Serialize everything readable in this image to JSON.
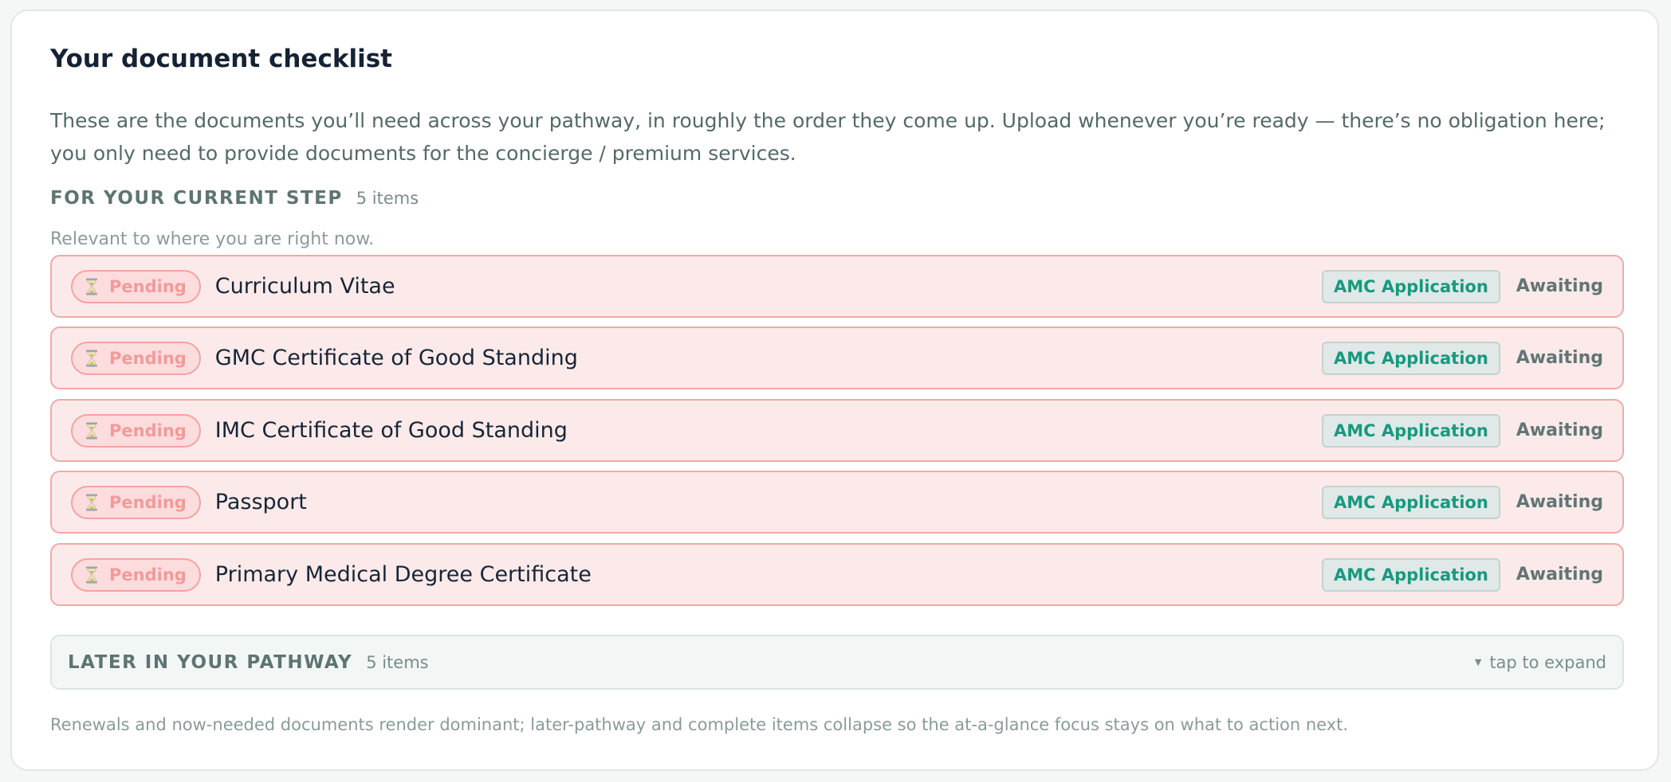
{
  "checklist": {
    "title": "Your document checklist",
    "intro": "These are the documents you’ll need across your pathway, in roughly the order they come up. Upload whenever you’re ready — there’s no obligation here; you only need to provide documents for the concierge / premium services.",
    "current_section": {
      "label": "FOR YOUR CURRENT STEP",
      "count": "5 items",
      "subtitle": "Relevant to where you are right now."
    },
    "documents": [
      {
        "status": "Pending",
        "status_icon": "hourglass-icon",
        "name": "Curriculum Vitae",
        "step": "AMC Application",
        "state": "Awaiting"
      },
      {
        "status": "Pending",
        "status_icon": "hourglass-icon",
        "name": "GMC Certificate of Good Standing",
        "step": "AMC Application",
        "state": "Awaiting"
      },
      {
        "status": "Pending",
        "status_icon": "hourglass-icon",
        "name": "IMC Certificate of Good Standing",
        "step": "AMC Application",
        "state": "Awaiting"
      },
      {
        "status": "Pending",
        "status_icon": "hourglass-icon",
        "name": "Passport",
        "step": "AMC Application",
        "state": "Awaiting"
      },
      {
        "status": "Pending",
        "status_icon": "hourglass-icon",
        "name": "Primary Medical Degree Certificate",
        "step": "AMC Application",
        "state": "Awaiting"
      }
    ],
    "later_section": {
      "label": "LATER IN YOUR PATHWAY",
      "count": "5 items",
      "expand_icon": "triangle-down-icon",
      "expand_hint": "tap to expand"
    },
    "footnote": "Renewals and now-needed documents render dominant; later-pathway and complete items collapse so the at-a-glance focus stays on what to action next."
  },
  "colors": {
    "title": "#152233",
    "pending_row_bg": "#fceaea",
    "pending_row_border": "#f3a8a8",
    "pending_text": "#f29a9a",
    "step_tag_text": "#17997f",
    "muted_text": "#5e7473"
  }
}
